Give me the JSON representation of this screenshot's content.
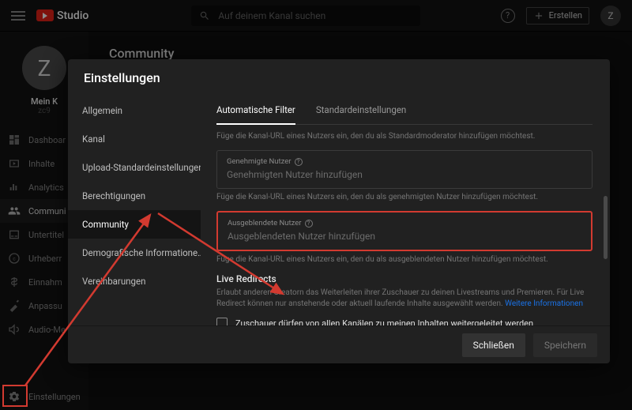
{
  "topbar": {
    "logo_text": "Studio",
    "search_placeholder": "Auf deinem Kanal suchen",
    "create_label": "Erstellen",
    "avatar_initial": "Z",
    "help_symbol": "?"
  },
  "sidebar": {
    "channel": {
      "initial": "Z",
      "name": "Mein K",
      "handle": "zc9"
    },
    "items": [
      {
        "label": "Dashboar"
      },
      {
        "label": "Inhalte"
      },
      {
        "label": "Analytics"
      },
      {
        "label": "Communi"
      },
      {
        "label": "Untertitel"
      },
      {
        "label": "Urheberr"
      },
      {
        "label": "Einnahm"
      },
      {
        "label": "Anpassu"
      },
      {
        "label": "Audio-Me"
      }
    ],
    "settings_label": "Einstellungen"
  },
  "main": {
    "page_title": "Community"
  },
  "modal": {
    "title": "Einstellungen",
    "nav": [
      "Allgemein",
      "Kanal",
      "Upload-Standardeinstellungen",
      "Berechtigungen",
      "Community",
      "Demografische Informatione…",
      "Vereinbarungen"
    ],
    "nav_active_index": 4,
    "tabs": [
      "Automatische Filter",
      "Standardeinstellungen"
    ],
    "tab_active_index": 0,
    "moderator_hint": "Füge die Kanal-URL eines Nutzers ein, den du als Standardmoderator hinzufügen möchtest.",
    "approved": {
      "label": "Genehmigte Nutzer",
      "placeholder": "Genehmigten Nutzer hinzufügen",
      "hint": "Füge die Kanal-URL eines Nutzers ein, den du als genehmigten Nutzer hinzufügen möchtest."
    },
    "hidden": {
      "label": "Ausgeblendete Nutzer",
      "placeholder": "Ausgeblendeten Nutzer hinzufügen",
      "hint": "Füge die Kanal-URL eines Nutzers ein, den du als ausgeblendeten Nutzer hinzufügen möchtest."
    },
    "live": {
      "heading": "Live Redirects",
      "desc_prefix": "Erlaubt anderen Creatorn das Weiterleiten ihrer Zuschauer zu deinen Livestreams und Premieren. Für Live Redirect können nur anstehende oder aktuell laufende Inhalte ausgewählt werden. ",
      "desc_link": "Weitere Informationen",
      "checkbox_label": "Zuschauer dürfen von allen Kanälen zu meinen Inhalten weitergeleitet werden"
    },
    "footer": {
      "close": "Schließen",
      "save": "Speichern"
    }
  }
}
